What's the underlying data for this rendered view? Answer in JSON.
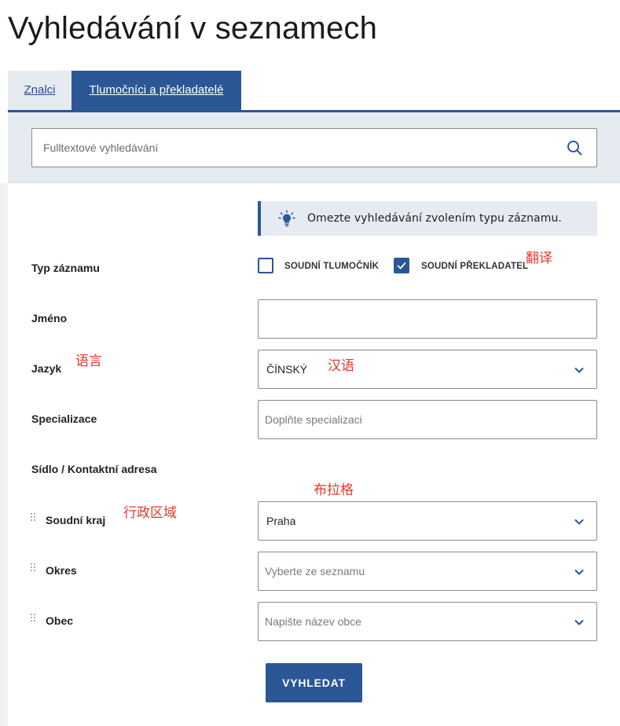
{
  "page": {
    "title": "Vyhledávání v seznamech"
  },
  "tabs": [
    {
      "label": "Znalci",
      "active": false
    },
    {
      "label": "Tlumočníci a překladatelé",
      "active": true
    }
  ],
  "search": {
    "placeholder": "Fulltextové vyhledávání",
    "icon": "search-icon"
  },
  "hint": {
    "icon": "lightbulb-icon",
    "text": "Omezte vyhledávání zvolením typu záznamu."
  },
  "form": {
    "record_type": {
      "label": "Typ záznamu",
      "options": [
        {
          "label": "SOUDNÍ TLUMOČNÍK",
          "checked": false
        },
        {
          "label": "SOUDNÍ PŘEKLADATEL",
          "checked": true
        }
      ]
    },
    "name": {
      "label": "Jméno",
      "value": ""
    },
    "language": {
      "label": "Jazyk",
      "value": "ČÍNSKÝ"
    },
    "specialization": {
      "label": "Specializace",
      "placeholder": "Doplňte specializaci"
    },
    "address": {
      "label": "Sídlo / Kontaktní adresa",
      "region": {
        "label": "Soudní kraj",
        "value": "Praha"
      },
      "district": {
        "label": "Okres",
        "placeholder": "Vyberte ze seznamu"
      },
      "municipality": {
        "label": "Obec",
        "placeholder": "Napište název obce"
      }
    },
    "submit_label": "VYHLEDAT"
  },
  "annotations": {
    "translator": "翻译",
    "language": "语言",
    "chinese": "汉语",
    "prague": "布拉格",
    "region": "行政区域"
  },
  "colors": {
    "primary": "#2b5797",
    "band": "#e6ebf1",
    "annotation": "#e8362b"
  }
}
